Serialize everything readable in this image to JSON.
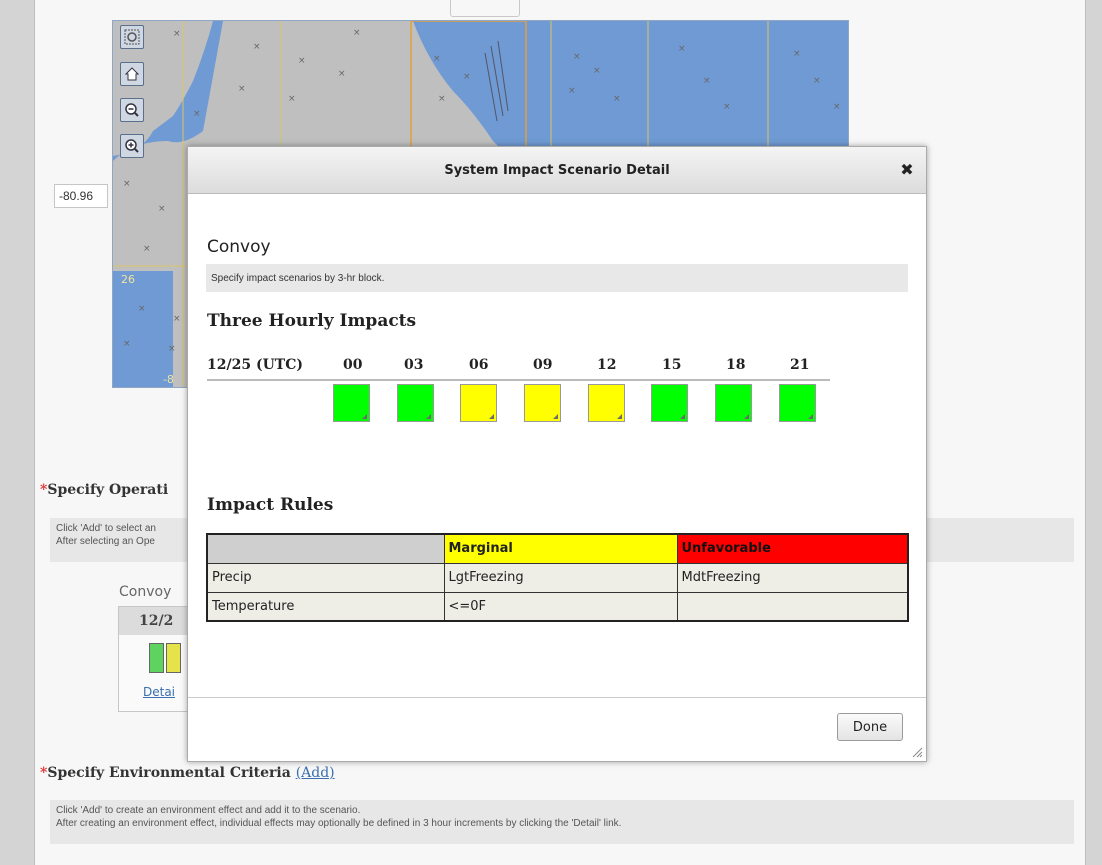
{
  "map": {
    "longitude_value": "-80.96",
    "grid_labels": [
      "26",
      "-8"
    ],
    "tools": [
      "zoom-box-icon",
      "home-icon",
      "zoom-out-icon",
      "zoom-in-icon"
    ]
  },
  "background": {
    "operations_title": "Specify Operati",
    "operations_help": [
      "Click 'Add' to select an",
      "After selecting an Ope"
    ],
    "convoy_label": "Convoy",
    "card_date": "12/2",
    "card_detail_link": "Detai",
    "env_title": "Specify Environmental Criteria",
    "env_add_link": "(Add)",
    "env_help": [
      "Click 'Add' to create an environment effect and add it to the scenario.",
      "After creating an environment effect, individual effects may optionally be defined in 3 hour increments by clicking the 'Detail' link."
    ],
    "required_marker": "*"
  },
  "modal": {
    "title": "System Impact Scenario Detail",
    "close_glyph": "✖",
    "operation_name": "Convoy",
    "operation_description": "Specify impact scenarios by 3-hr block.",
    "three_hourly_heading": "Three Hourly Impacts",
    "date_label": "12/25 (UTC)",
    "hours": [
      "00",
      "03",
      "06",
      "09",
      "12",
      "15",
      "18",
      "21"
    ],
    "impact_levels": [
      "favorable",
      "favorable",
      "marginal",
      "marginal",
      "marginal",
      "favorable",
      "favorable",
      "favorable"
    ],
    "impact_colors": {
      "favorable": "#00ff00",
      "marginal": "#ffff00",
      "unfavorable": "#ff0000"
    },
    "rules_heading": "Impact Rules",
    "rules_table": {
      "headers": [
        "",
        "Marginal",
        "Unfavorable"
      ],
      "rows": [
        [
          "Precip",
          "LgtFreezing",
          "MdtFreezing"
        ],
        [
          "Temperature",
          "<=0F",
          ""
        ]
      ]
    },
    "done_label": "Done"
  }
}
